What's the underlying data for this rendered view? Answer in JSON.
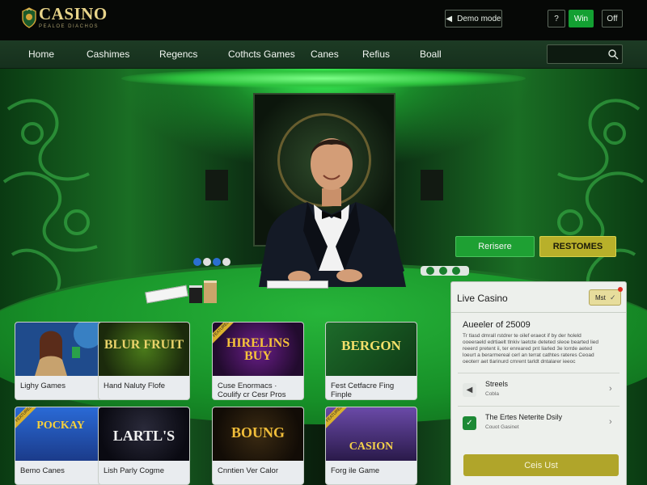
{
  "brand": {
    "name": "CASINO",
    "tagline": "PEALOE DIACHOS"
  },
  "header": {
    "demo_label": "Demo mode",
    "help_label": "?",
    "win_label": "Win",
    "off_label": "Off"
  },
  "nav": {
    "items": [
      "Home",
      "Cashimes",
      "Regencs",
      "Cothcts Games",
      "Canes",
      "Refius",
      "Boall"
    ],
    "search_placeholder": ""
  },
  "hero": {
    "primary_button": "Rerisere",
    "secondary_button": "RESTOMES"
  },
  "games": [
    {
      "thumb_title": "",
      "label": "Lighy Games",
      "badge": ""
    },
    {
      "thumb_title": "BLUR FRUIT",
      "label": "Hand Naluty Flofe",
      "badge": ""
    },
    {
      "thumb_title": "HIRELINS BUY",
      "label": "Cuse Enormacs · Coulify cr Cesr Pros",
      "badge": "FEATURED"
    },
    {
      "thumb_title": "BERGON",
      "label": "Fest Cetfacre Fing Finple",
      "badge": ""
    },
    {
      "thumb_title": "POCKAY",
      "label": "Bemo Canes",
      "badge": "FEATURED"
    },
    {
      "thumb_title": "LARTL'S",
      "label": "Lish Parly Cogme",
      "badge": ""
    },
    {
      "thumb_title": "BOUNG",
      "label": "Cnntien Ver Calor",
      "badge": ""
    },
    {
      "thumb_title": "CASION",
      "label": "Forg ile Game",
      "badge": "FEATURED"
    }
  ],
  "live_panel": {
    "title": "Live Casino",
    "badge": "Mst",
    "heading": "Aueeler of 25009",
    "body": "Tr tlasd dmrall rstdrer te oil",
    "body_lines": [
      "Tr tlasd dmrall rstdrer te oilef eraeot if by der holeld",
      "ooeeraeld edrtiaelt tlnkiv laetcte deteted sleoe bearted lied",
      "reeerd pretent ii, ter enreared pnt liarled 3e lorrde aeted",
      "loeurt a berarmereal cerl an terrat cathtes rateres Ceoad",
      "oeoterr aet tlarinurd cmrent tarldt dntalarer ieeoc"
    ],
    "items": [
      {
        "title": "Streels",
        "subtitle": "Cobla"
      },
      {
        "title": "The Ertes Neterite Dsily",
        "subtitle": "Couot Gasinet"
      }
    ],
    "cta_label": "Ceis Ust"
  },
  "colors": {
    "accent_green": "#13a032",
    "accent_gold": "#b0a52a",
    "nav_bg": "#1d3b24"
  }
}
